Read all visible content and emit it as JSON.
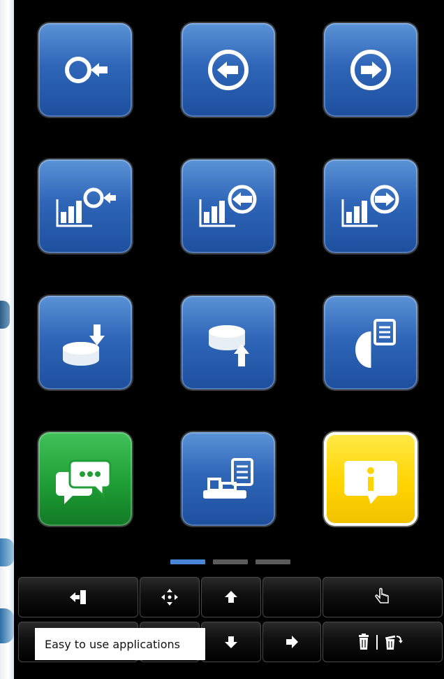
{
  "icons": [
    {
      "name": "logout-icon",
      "color": "blue"
    },
    {
      "name": "back-arrow-icon",
      "color": "blue"
    },
    {
      "name": "forward-arrow-icon",
      "color": "blue"
    },
    {
      "name": "chart-logout-icon",
      "color": "blue"
    },
    {
      "name": "chart-back-icon",
      "color": "blue"
    },
    {
      "name": "chart-forward-icon",
      "color": "blue"
    },
    {
      "name": "database-download-icon",
      "color": "blue"
    },
    {
      "name": "database-upload-icon",
      "color": "blue"
    },
    {
      "name": "database-document-icon",
      "color": "blue"
    },
    {
      "name": "chat-bubbles-icon",
      "color": "green"
    },
    {
      "name": "device-document-icon",
      "color": "blue"
    },
    {
      "name": "info-bubble-icon",
      "color": "yellow"
    }
  ],
  "pager": {
    "pages": 3,
    "active": 1
  },
  "toolbar": {
    "row1": [
      "exit-icon",
      "move-icon",
      "arrow-up-icon",
      "",
      "hand-pointer-icon"
    ],
    "row2": [
      "",
      "",
      "arrow-down-icon",
      "arrow-right-icon",
      "trash-restore-icon"
    ]
  },
  "tooltip": {
    "text": "Easy to use applications"
  },
  "colors": {
    "tile_blue": "#2f66b8",
    "tile_green": "#1f9e35",
    "tile_yellow": "#ffd500",
    "pager_active": "#4a86d8",
    "pager_inactive": "#5b5b5b"
  }
}
